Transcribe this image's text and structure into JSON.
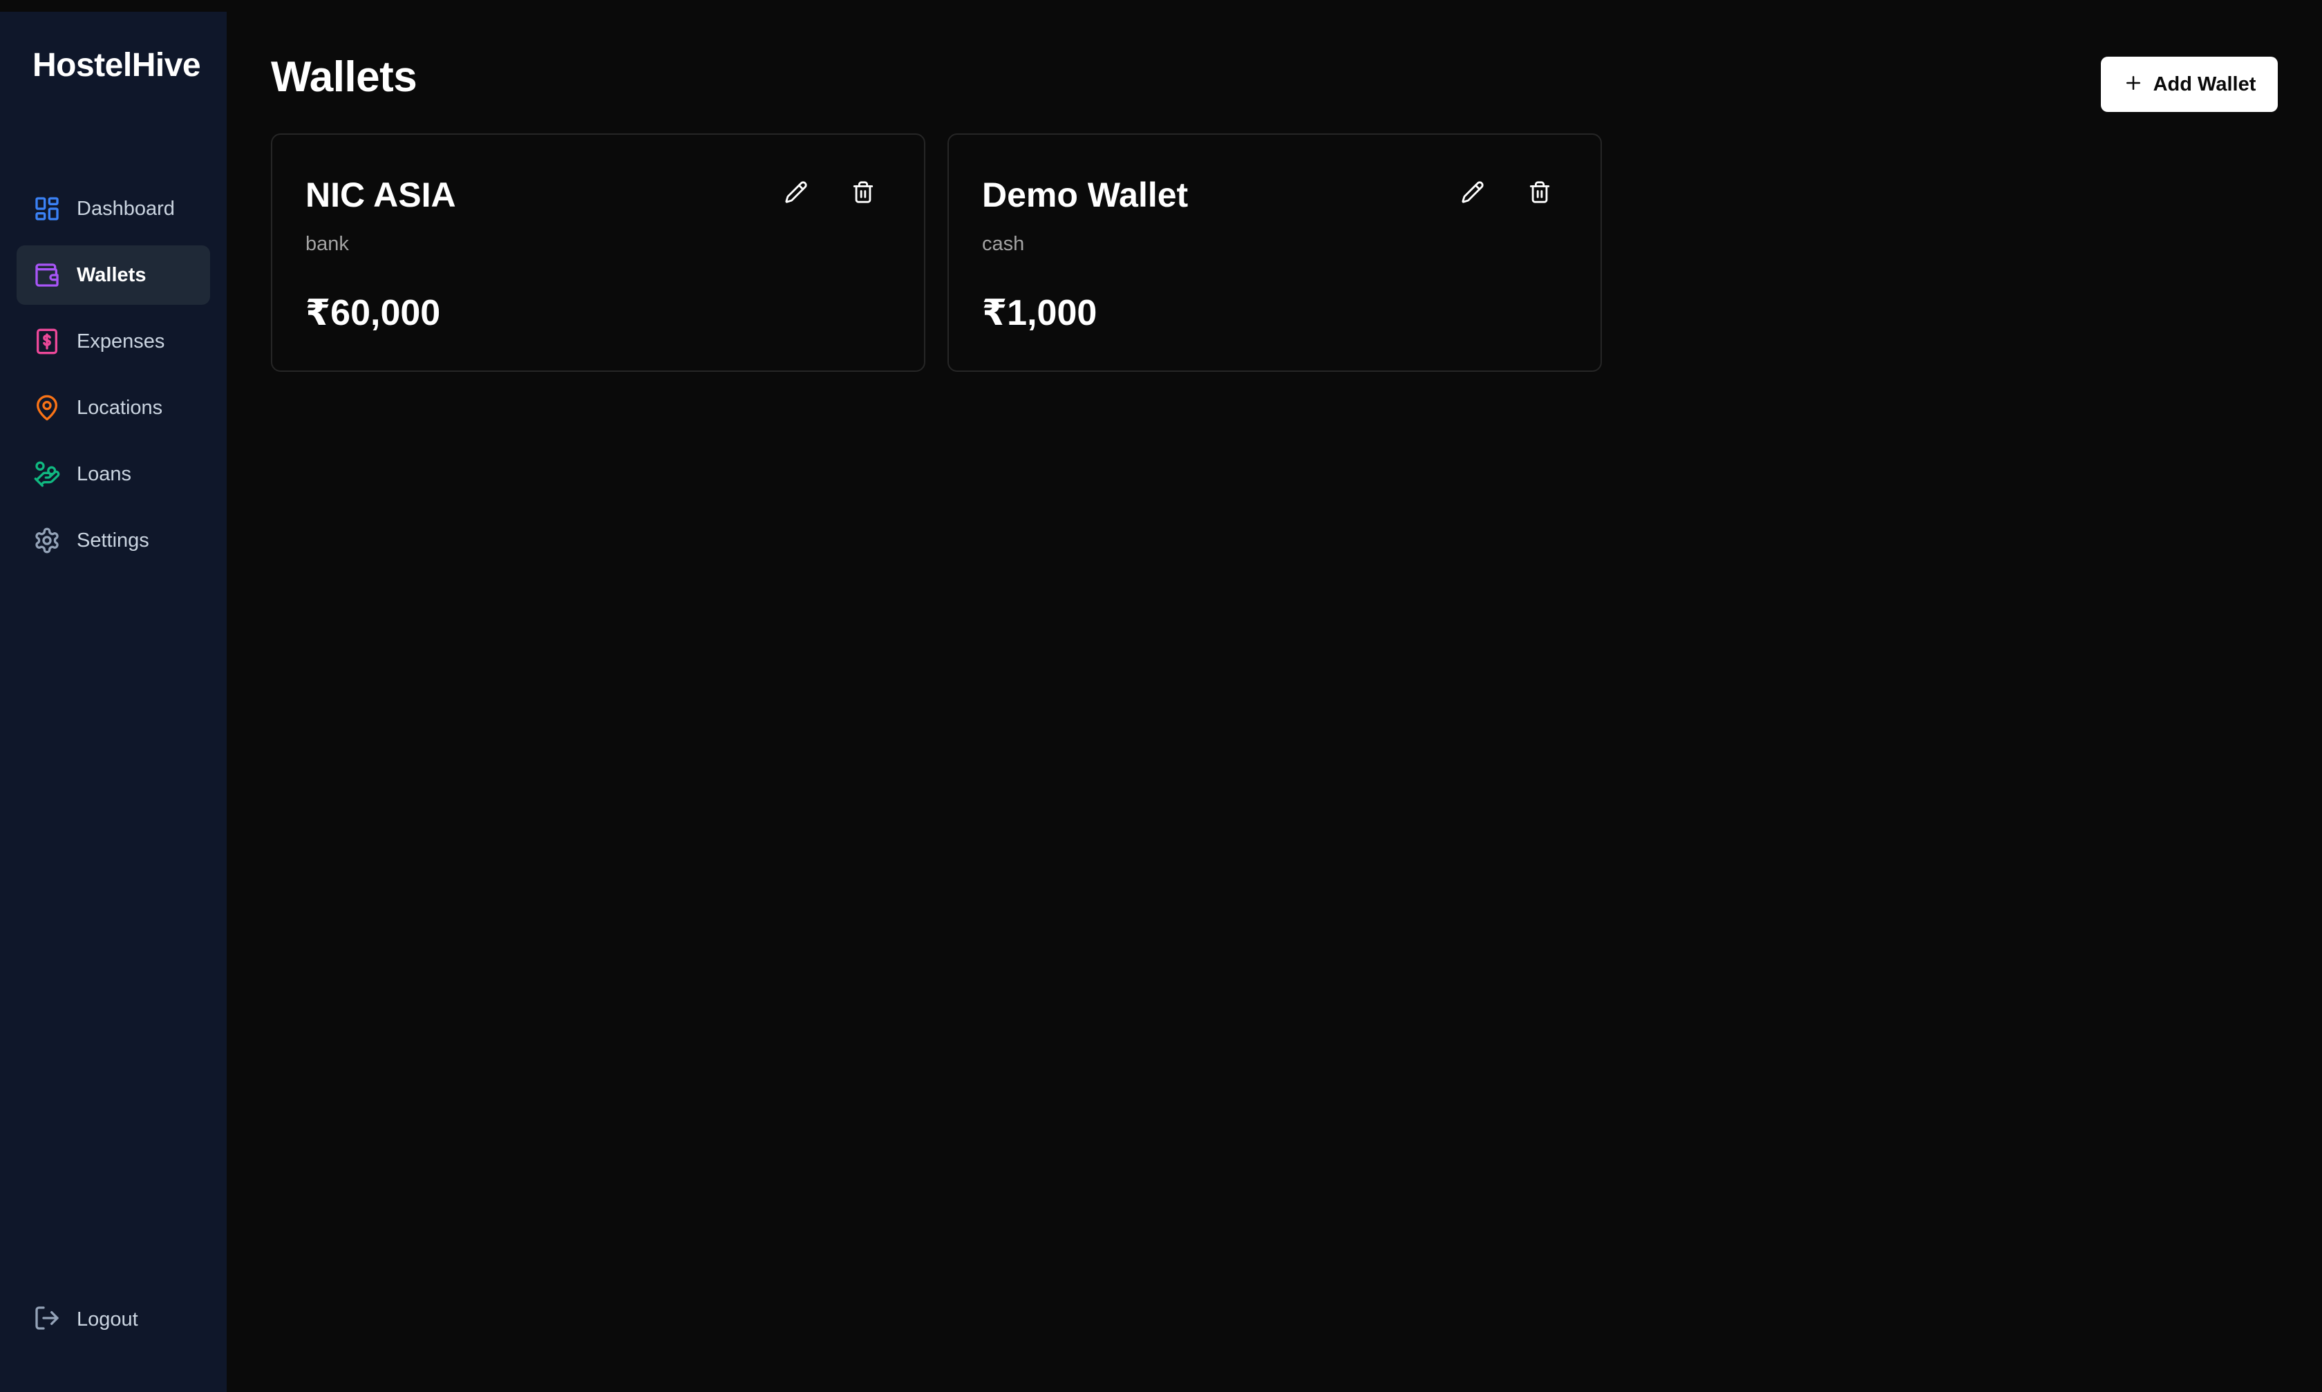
{
  "app": {
    "brand": "HostelHive"
  },
  "sidebar": {
    "items": [
      {
        "label": "Dashboard",
        "icon": "dashboard-icon",
        "color": "#3b82f6",
        "active": false
      },
      {
        "label": "Wallets",
        "icon": "wallet-icon",
        "color": "#a855f7",
        "active": true
      },
      {
        "label": "Expenses",
        "icon": "expense-icon",
        "color": "#ec4899",
        "active": false
      },
      {
        "label": "Locations",
        "icon": "map-pin-icon",
        "color": "#f97316",
        "active": false
      },
      {
        "label": "Loans",
        "icon": "hand-coins-icon",
        "color": "#10b981",
        "active": false
      },
      {
        "label": "Settings",
        "icon": "gear-icon",
        "color": "#94a3b8",
        "active": false
      }
    ],
    "logout_label": "Logout"
  },
  "main": {
    "title": "Wallets",
    "add_button_label": "Add Wallet",
    "wallets": [
      {
        "name": "NIC ASIA",
        "type": "bank",
        "balance": "₹60,000"
      },
      {
        "name": "Demo Wallet",
        "type": "cash",
        "balance": "₹1,000"
      }
    ]
  },
  "colors": {
    "background": "#0a0a0a",
    "sidebar": "#0f172a",
    "active_item": "#1f2937",
    "card_border": "#262626"
  }
}
